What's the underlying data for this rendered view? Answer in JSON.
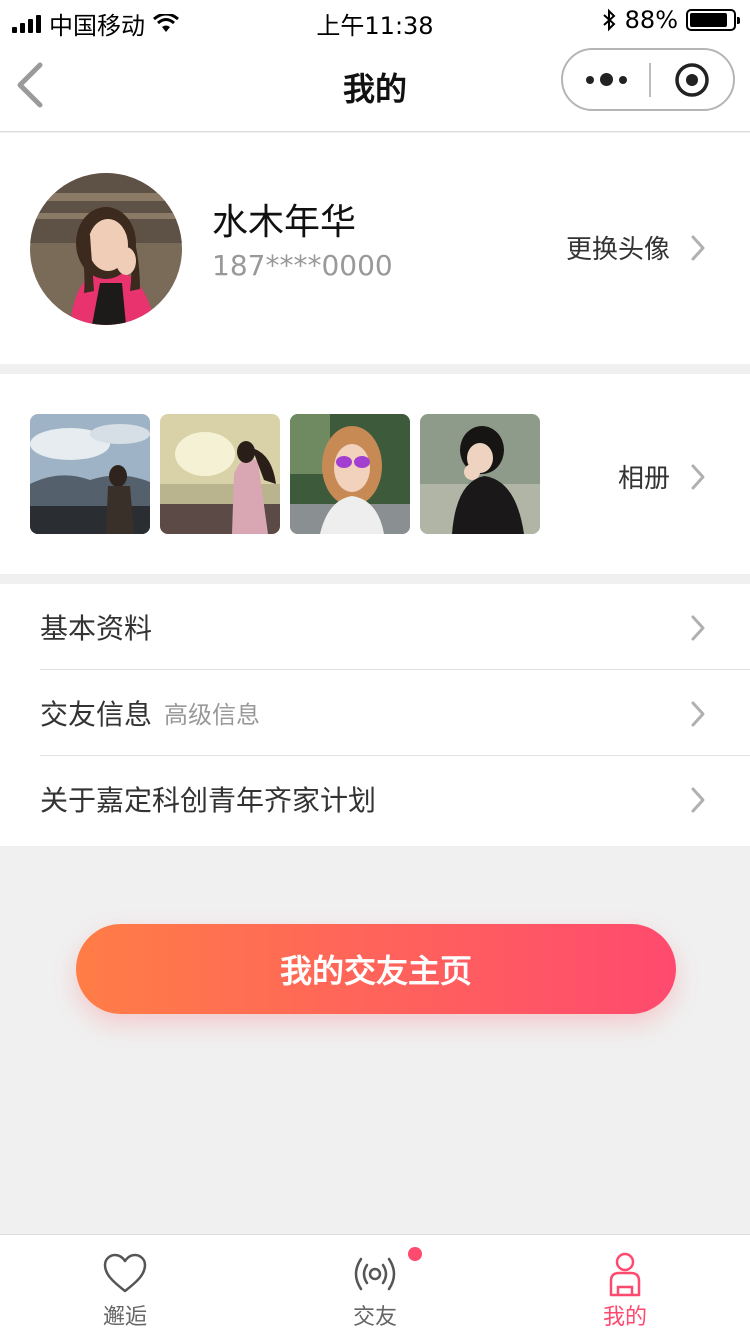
{
  "status_bar": {
    "carrier": "中国移动",
    "time": "上午11:38",
    "battery": "88%",
    "battery_level": 0.88
  },
  "nav": {
    "title": "我的"
  },
  "profile": {
    "name": "水木年华",
    "phone": "187****0000",
    "change_avatar_label": "更换头像"
  },
  "album": {
    "label": "相册",
    "photo_count": 4
  },
  "menu": {
    "items": [
      {
        "label": "基本资料",
        "sub": ""
      },
      {
        "label": "交友信息",
        "sub": "高级信息"
      },
      {
        "label": "关于嘉定科创青年齐家计划",
        "sub": ""
      }
    ]
  },
  "primary_button": {
    "label": "我的交友主页"
  },
  "tabs": [
    {
      "label": "邂逅",
      "icon": "heart-icon",
      "active": false
    },
    {
      "label": "交友",
      "icon": "broadcast-icon",
      "active": false,
      "badge": true
    },
    {
      "label": "我的",
      "icon": "person-icon",
      "active": true
    }
  ],
  "colors": {
    "accent": "#ff4a6f",
    "gradient_start": "#ff7d46",
    "gradient_end": "#ff4a6f",
    "background": "#f0f0f0"
  }
}
